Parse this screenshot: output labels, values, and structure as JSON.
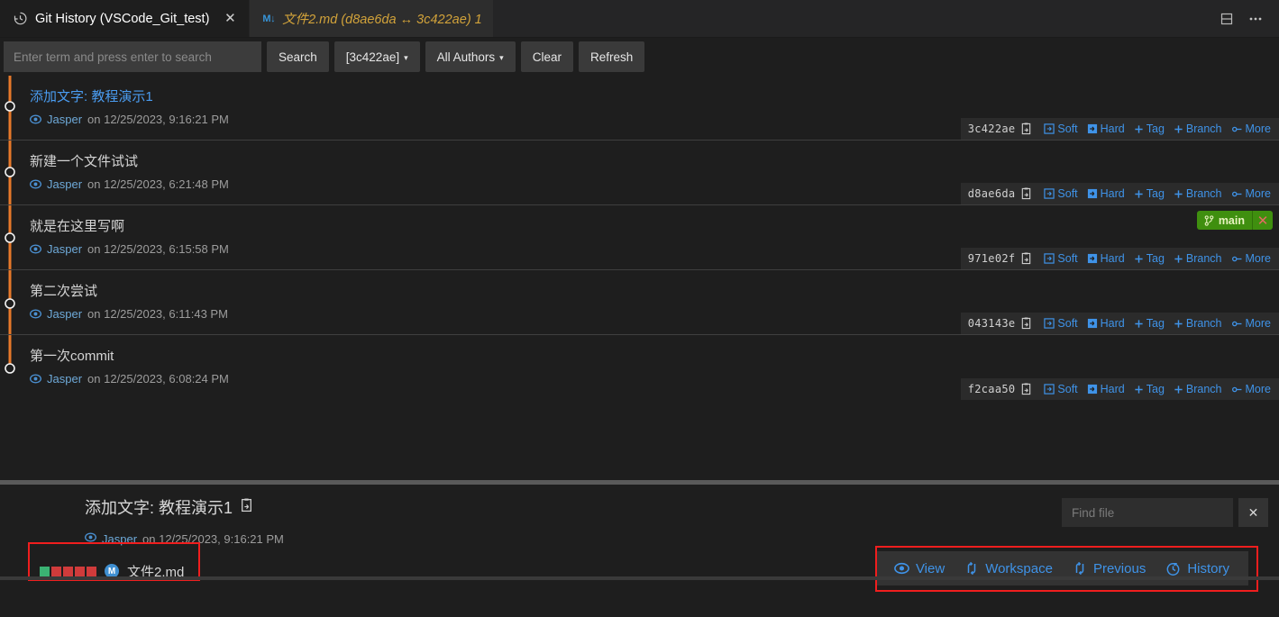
{
  "window": {
    "tabs": [
      {
        "id": "git-history",
        "label": "Git History (VSCode_Git_test)",
        "icon": "history-icon",
        "active": true,
        "close_label": "✕"
      },
      {
        "id": "diff",
        "label": "文件2.md (d8ae6da ↔ 3c422ae) 1",
        "icon": "markdown-icon",
        "icon_text": "M↓",
        "active": false
      }
    ],
    "actions": [
      {
        "name": "split-editor-icon",
        "label": "Split Editor"
      },
      {
        "name": "more-actions-icon",
        "label": "···"
      }
    ]
  },
  "toolbar": {
    "search_placeholder": "Enter term and press enter to search",
    "search_value": "",
    "buttons": [
      {
        "name": "search-button",
        "label": "Search",
        "caret": false
      },
      {
        "name": "branch-filter",
        "label": "[3c422ae]",
        "caret": true
      },
      {
        "name": "authors-filter",
        "label": "All Authors",
        "caret": true
      },
      {
        "name": "clear-button",
        "label": "Clear",
        "caret": false
      },
      {
        "name": "refresh-button",
        "label": "Refresh",
        "caret": false
      }
    ],
    "caret_glyph": "▾"
  },
  "commit_actions": {
    "soft": "Soft",
    "hard": "Hard",
    "tag": "Tag",
    "branch": "Branch",
    "more": "More",
    "plus": "＋"
  },
  "commits": [
    {
      "subject": "添加文字: 教程演示1",
      "author": "Jasper",
      "date_text": "on 12/25/2023, 9:16:21 PM",
      "hash": "3c422ae",
      "selected": true,
      "branch": null
    },
    {
      "subject": "新建一个文件试试",
      "author": "Jasper",
      "date_text": "on 12/25/2023, 6:21:48 PM",
      "hash": "d8ae6da",
      "selected": false,
      "branch": null
    },
    {
      "subject": "就是在这里写啊",
      "author": "Jasper",
      "date_text": "on 12/25/2023, 6:15:58 PM",
      "hash": "971e02f",
      "selected": false,
      "branch": {
        "name": "main",
        "close": "✕"
      }
    },
    {
      "subject": "第二次尝试",
      "author": "Jasper",
      "date_text": "on 12/25/2023, 6:11:43 PM",
      "hash": "043143e",
      "selected": false,
      "branch": null
    },
    {
      "subject": "第一次commit",
      "author": "Jasper",
      "date_text": "on 12/25/2023, 6:08:24 PM",
      "hash": "f2caa50",
      "selected": false,
      "branch": null
    }
  ],
  "details": {
    "title": "添加文字: 教程演示1",
    "author": "Jasper",
    "date_text": "on 12/25/2023, 9:16:21 PM",
    "find_placeholder": "Find file",
    "find_value": "",
    "find_close": "✕",
    "file": {
      "name": "文件2.md",
      "status_badge": "M",
      "diff_squares": [
        "#3bb273",
        "#d03b3b",
        "#d03b3b",
        "#d03b3b",
        "#d03b3b"
      ]
    },
    "file_actions": [
      {
        "name": "view-button",
        "label": "View",
        "icon": "eye-icon"
      },
      {
        "name": "workspace-button",
        "label": "Workspace",
        "icon": "compare-icon"
      },
      {
        "name": "previous-button",
        "label": "Previous",
        "icon": "compare-icon"
      },
      {
        "name": "history-button",
        "label": "History",
        "icon": "history-icon"
      }
    ]
  },
  "colors": {
    "accent_link": "#3f93e8",
    "selected_commit": "#4a9cf0",
    "graph_line": "#e8792a",
    "branch_badge": "#3f8f0f",
    "tab_inactive_text": "#d1a23a",
    "highlight_box": "#f01e1e",
    "background": "#1e1e1e"
  }
}
